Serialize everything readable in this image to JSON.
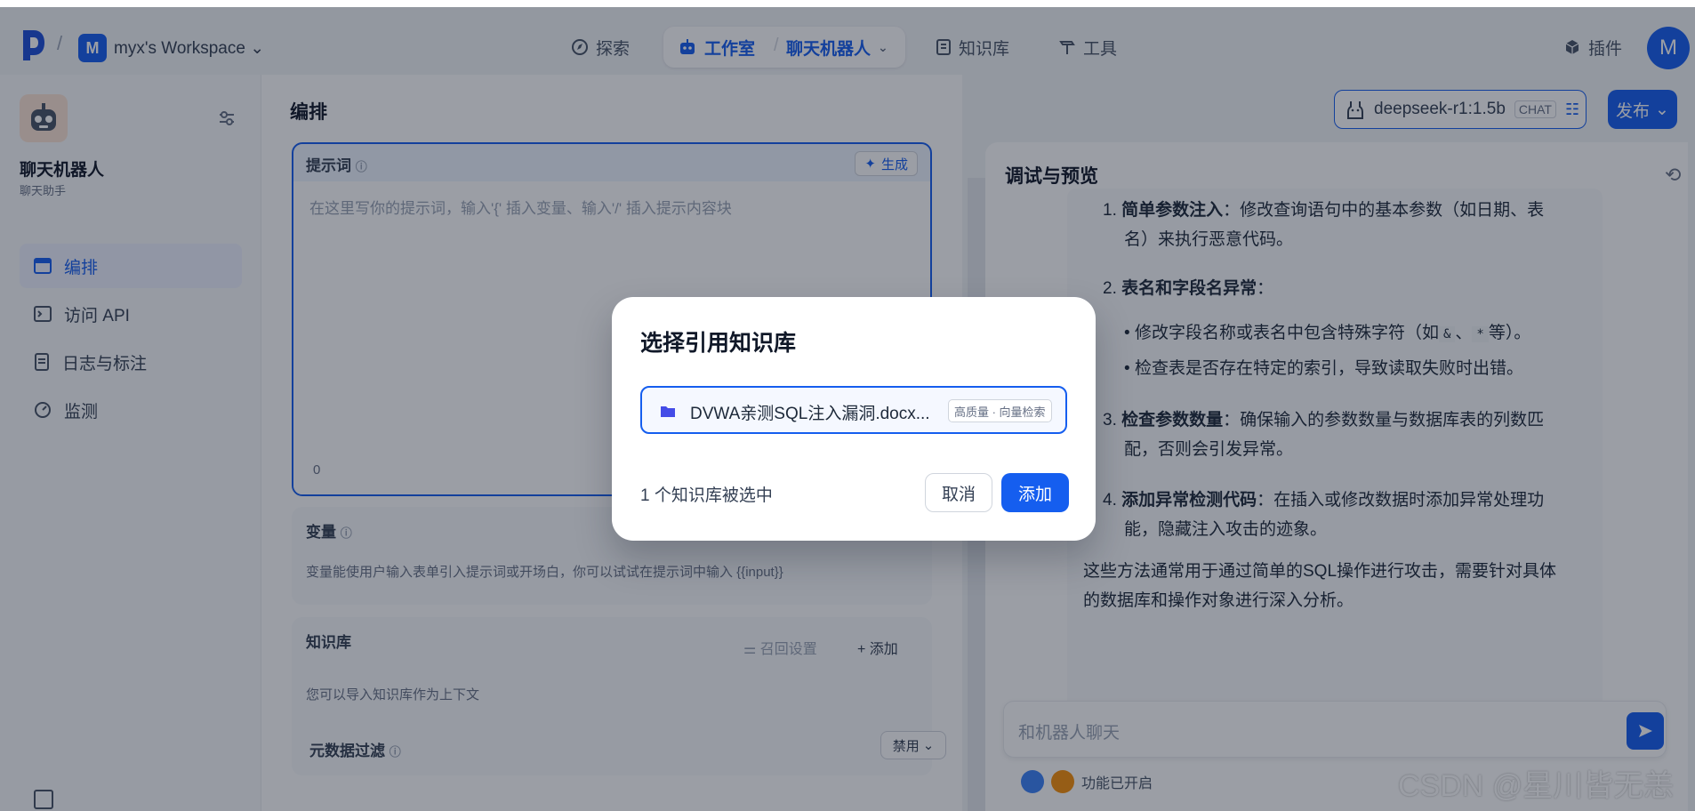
{
  "header": {
    "workspace_initial": "M",
    "workspace_name": "myx's Workspace",
    "nav": {
      "explore": "探索",
      "studio": "工作室",
      "current_app": "聊天机器人",
      "knowledge": "知识库",
      "tools": "工具",
      "plugins": "插件"
    },
    "user_initial": "M"
  },
  "sidebar": {
    "app_name": "聊天机器人",
    "app_desc": "聊天助手",
    "items": [
      {
        "label": "编排",
        "active": true
      },
      {
        "label": "访问 API",
        "active": false
      },
      {
        "label": "日志与标注",
        "active": false
      },
      {
        "label": "监测",
        "active": false
      }
    ]
  },
  "orchestrate": {
    "title": "编排",
    "prompt": {
      "label": "提示词",
      "generate": "生成",
      "placeholder": "在这里写你的提示词，输入'{' 插入变量、输入'/' 插入提示内容块",
      "count": "0"
    },
    "variables": {
      "title": "变量",
      "desc": "变量能使用户输入表单引入提示词或开场白，你可以试试在提示词中输入 {{input}}"
    },
    "knowledge": {
      "title": "知识库",
      "recall": "召回设置",
      "add": "添加",
      "desc": "您可以导入知识库作为上下文",
      "meta_filter": "元数据过滤",
      "meta_value": "禁用"
    }
  },
  "model": {
    "name": "deepseek-r1:1.5b",
    "mode": "CHAT",
    "publish": "发布"
  },
  "preview": {
    "title": "调试与预览",
    "item1_num": "1.",
    "item1_bold": "简单参数注入",
    "item1_text_a": "：修改查询语句中的基本参数（如日期、表",
    "item1_text_b": "名）来执行恶意代码。",
    "item2_num": "2.",
    "item2_bold": "表名和字段名异常",
    "item2_colon": "：",
    "item2_sub1_a": "修改字段名称或表名中包含特殊字符（如",
    "item2_sub1_code1": "&",
    "item2_sub1_sep": "、",
    "item2_sub1_code2": "*",
    "item2_sub1_b": "等）。",
    "item2_sub2": "检查表是否存在特定的索引，导致读取失败时出错。",
    "item3_num": "3.",
    "item3_bold": "检查参数数量",
    "item3_text_a": "：确保输入的参数数量与数据库表的列数匹",
    "item3_text_b": "配，否则会引发异常。",
    "item4_num": "4.",
    "item4_bold": "添加异常检测代码",
    "item4_text_a": "：在插入或修改数据时添加异常处理功",
    "item4_text_b": "能，隐藏注入攻击的迹象。",
    "summary_a": "这些方法通常用于通过简单的SQL操作进行攻击，需要针对具体",
    "summary_b": "的数据库和操作对象进行深入分析。",
    "input_placeholder": "和机器人聊天",
    "features": "功能已开启"
  },
  "modal": {
    "title": "选择引用知识库",
    "item_name": "DVWA亲测SQL注入漏洞.docx...",
    "item_tag": "高质量 · 向量检索",
    "selected_count": "1 个知识库被选中",
    "cancel": "取消",
    "add": "添加"
  },
  "watermark": "CSDN @星川皆无恙",
  "colors": {
    "accent": "#155eef",
    "overlay": "rgba(16,24,40,0.42)"
  }
}
